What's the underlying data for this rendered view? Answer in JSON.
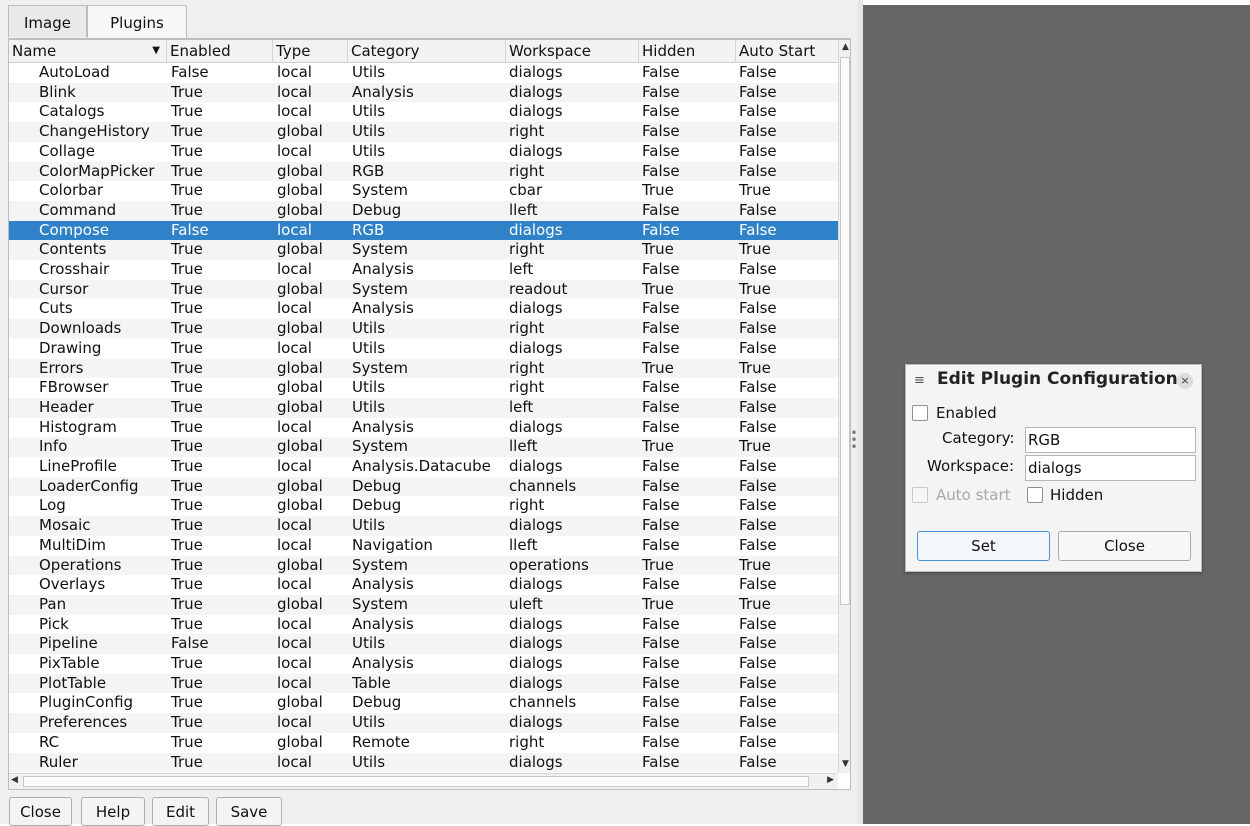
{
  "tabs": [
    {
      "label": "Image",
      "active": false
    },
    {
      "label": "Plugins",
      "active": true
    }
  ],
  "table": {
    "sort_column": "Name",
    "columns": [
      "Name",
      "Enabled",
      "Type",
      "Category",
      "Workspace",
      "Hidden",
      "Auto Start"
    ],
    "selected_row": "Compose",
    "rows": [
      [
        "AutoLoad",
        "False",
        "local",
        "Utils",
        "dialogs",
        "False",
        "False"
      ],
      [
        "Blink",
        "True",
        "local",
        "Analysis",
        "dialogs",
        "False",
        "False"
      ],
      [
        "Catalogs",
        "True",
        "local",
        "Utils",
        "dialogs",
        "False",
        "False"
      ],
      [
        "ChangeHistory",
        "True",
        "global",
        "Utils",
        "right",
        "False",
        "False"
      ],
      [
        "Collage",
        "True",
        "local",
        "Utils",
        "dialogs",
        "False",
        "False"
      ],
      [
        "ColorMapPicker",
        "True",
        "global",
        "RGB",
        "right",
        "False",
        "False"
      ],
      [
        "Colorbar",
        "True",
        "global",
        "System",
        "cbar",
        "True",
        "True"
      ],
      [
        "Command",
        "True",
        "global",
        "Debug",
        "lleft",
        "False",
        "False"
      ],
      [
        "Compose",
        "False",
        "local",
        "RGB",
        "dialogs",
        "False",
        "False"
      ],
      [
        "Contents",
        "True",
        "global",
        "System",
        "right",
        "True",
        "True"
      ],
      [
        "Crosshair",
        "True",
        "local",
        "Analysis",
        "left",
        "False",
        "False"
      ],
      [
        "Cursor",
        "True",
        "global",
        "System",
        "readout",
        "True",
        "True"
      ],
      [
        "Cuts",
        "True",
        "local",
        "Analysis",
        "dialogs",
        "False",
        "False"
      ],
      [
        "Downloads",
        "True",
        "global",
        "Utils",
        "right",
        "False",
        "False"
      ],
      [
        "Drawing",
        "True",
        "local",
        "Utils",
        "dialogs",
        "False",
        "False"
      ],
      [
        "Errors",
        "True",
        "global",
        "System",
        "right",
        "True",
        "True"
      ],
      [
        "FBrowser",
        "True",
        "global",
        "Utils",
        "right",
        "False",
        "False"
      ],
      [
        "Header",
        "True",
        "global",
        "Utils",
        "left",
        "False",
        "False"
      ],
      [
        "Histogram",
        "True",
        "local",
        "Analysis",
        "dialogs",
        "False",
        "False"
      ],
      [
        "Info",
        "True",
        "global",
        "System",
        "lleft",
        "True",
        "True"
      ],
      [
        "LineProfile",
        "True",
        "local",
        "Analysis.Datacube",
        "dialogs",
        "False",
        "False"
      ],
      [
        "LoaderConfig",
        "True",
        "global",
        "Debug",
        "channels",
        "False",
        "False"
      ],
      [
        "Log",
        "True",
        "global",
        "Debug",
        "right",
        "False",
        "False"
      ],
      [
        "Mosaic",
        "True",
        "local",
        "Utils",
        "dialogs",
        "False",
        "False"
      ],
      [
        "MultiDim",
        "True",
        "local",
        "Navigation",
        "lleft",
        "False",
        "False"
      ],
      [
        "Operations",
        "True",
        "global",
        "System",
        "operations",
        "True",
        "True"
      ],
      [
        "Overlays",
        "True",
        "local",
        "Analysis",
        "dialogs",
        "False",
        "False"
      ],
      [
        "Pan",
        "True",
        "global",
        "System",
        "uleft",
        "True",
        "True"
      ],
      [
        "Pick",
        "True",
        "local",
        "Analysis",
        "dialogs",
        "False",
        "False"
      ],
      [
        "Pipeline",
        "False",
        "local",
        "Utils",
        "dialogs",
        "False",
        "False"
      ],
      [
        "PixTable",
        "True",
        "local",
        "Analysis",
        "dialogs",
        "False",
        "False"
      ],
      [
        "PlotTable",
        "True",
        "local",
        "Table",
        "dialogs",
        "False",
        "False"
      ],
      [
        "PluginConfig",
        "True",
        "global",
        "Debug",
        "channels",
        "False",
        "False"
      ],
      [
        "Preferences",
        "True",
        "local",
        "Utils",
        "dialogs",
        "False",
        "False"
      ],
      [
        "RC",
        "True",
        "global",
        "Remote",
        "right",
        "False",
        "False"
      ],
      [
        "Ruler",
        "True",
        "local",
        "Utils",
        "dialogs",
        "False",
        "False"
      ]
    ]
  },
  "buttons": {
    "close": "Close",
    "help": "Help",
    "edit": "Edit",
    "save": "Save"
  },
  "icons": {
    "sort": "sort-descending-icon",
    "menu": "menu-icon",
    "close": "close-icon",
    "scroll_up": "arrow-up-icon",
    "scroll_down": "arrow-down-icon",
    "scroll_left": "arrow-left-icon",
    "scroll_right": "arrow-right-icon",
    "splitter": "drag-handle-icon"
  },
  "colors": {
    "selection": "#2f82c8",
    "canvas": "#666666"
  },
  "dialog": {
    "title": "Edit Plugin Configuration",
    "enabled_label": "Enabled",
    "enabled_checked": false,
    "category_label": "Category:",
    "category_value": "RGB",
    "workspace_label": "Workspace:",
    "workspace_value": "dialogs",
    "autostart_label": "Auto start",
    "autostart_checked": false,
    "autostart_disabled": true,
    "hidden_label": "Hidden",
    "hidden_checked": false,
    "set_label": "Set",
    "close_label": "Close"
  }
}
